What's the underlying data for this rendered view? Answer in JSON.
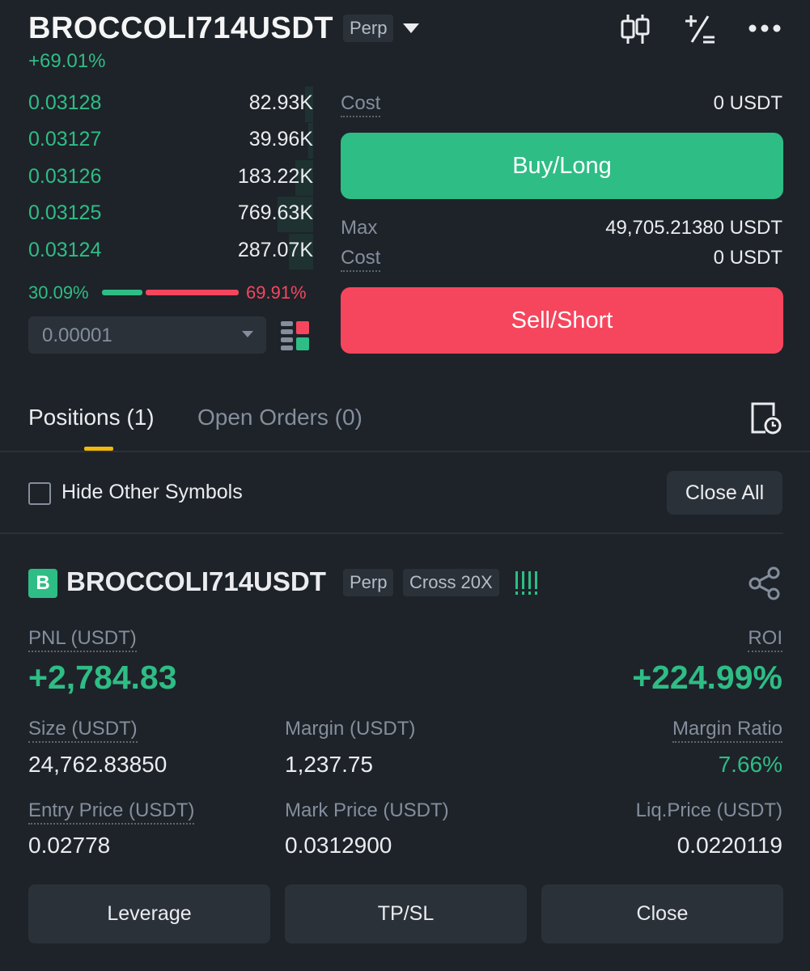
{
  "header": {
    "symbol": "BROCCOLI714USDT",
    "contract_type": "Perp",
    "change": "+69.01%",
    "icons": [
      "candlestick-icon",
      "plus-minus-icon",
      "more-icon"
    ]
  },
  "order_book": {
    "rows": [
      {
        "price": "0.03128",
        "qty": "82.93K",
        "depth": 0.1
      },
      {
        "price": "0.03127",
        "qty": "39.96K",
        "depth": 0.05
      },
      {
        "price": "0.03126",
        "qty": "183.22K",
        "depth": 0.15
      },
      {
        "price": "0.03125",
        "qty": "769.63K",
        "depth": 0.3
      },
      {
        "price": "0.03124",
        "qty": "287.07K",
        "depth": 0.2
      }
    ],
    "buy_ratio": "30.09%",
    "sell_ratio": "69.91%",
    "tick_size": "0.00001"
  },
  "order_panel": {
    "cost_label": "Cost",
    "cost_buy": "0 USDT",
    "buy_label": "Buy/Long",
    "max_label": "Max",
    "max_value": "49,705.21380 USDT",
    "cost_sell": "0 USDT",
    "sell_label": "Sell/Short"
  },
  "tabs": {
    "positions": "Positions (1)",
    "open_orders": "Open Orders (0)"
  },
  "filter": {
    "hide_label": "Hide Other Symbols",
    "close_all": "Close All"
  },
  "position": {
    "side": "B",
    "symbol": "BROCCOLI714USDT",
    "contract": "Perp",
    "margin_mode": "Cross 20X",
    "pnl_label": "PNL (USDT)",
    "pnl": "+2,784.83",
    "roi_label": "ROI",
    "roi": "+224.99%",
    "size_label": "Size (USDT)",
    "size": "24,762.83850",
    "margin_label": "Margin (USDT)",
    "margin": "1,237.75",
    "margin_ratio_label": "Margin Ratio",
    "margin_ratio": "7.66%",
    "entry_label": "Entry Price (USDT)",
    "entry": "0.02778",
    "mark_label": "Mark Price (USDT)",
    "mark": "0.0312900",
    "liq_label": "Liq.Price (USDT)",
    "liq": "0.0220119",
    "buttons": {
      "leverage": "Leverage",
      "tpsl": "TP/SL",
      "close": "Close"
    }
  },
  "colors": {
    "background": "#1e2329",
    "buy": "#2ebd85",
    "sell": "#f6465d",
    "accent": "#f0b90b",
    "panel": "#2b3139"
  }
}
